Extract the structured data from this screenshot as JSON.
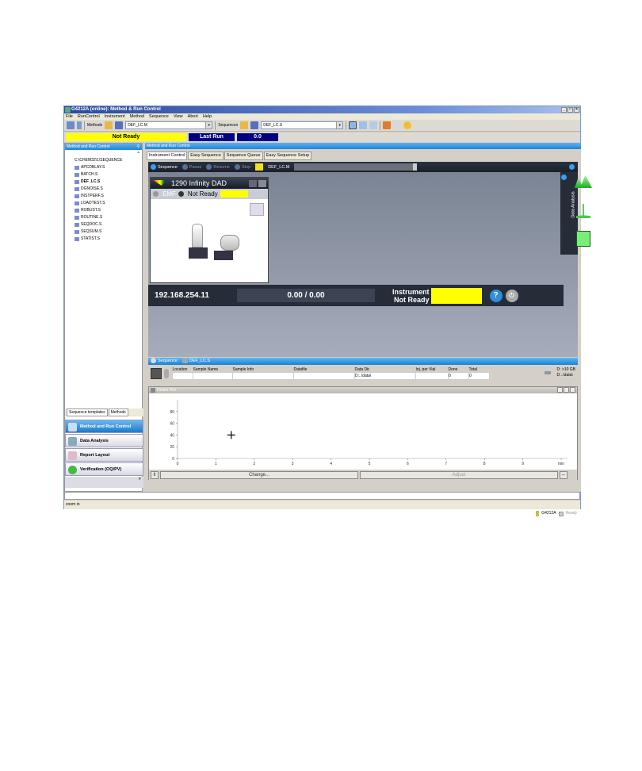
{
  "window": {
    "title": "G4212A (online): Method & Run Control",
    "controls": [
      "_",
      "□",
      "×"
    ]
  },
  "menu": [
    "File",
    "RunControl",
    "Instrument",
    "Method",
    "Sequence",
    "View",
    "Abort",
    "Help"
  ],
  "toolbar": {
    "methods_label": "Methods",
    "method_value": "DEF_LC.M",
    "sequences_label": "Sequences",
    "sequence_value": "DEF_LC.S"
  },
  "status_row": {
    "status": "Not Ready",
    "last_run_label": "Last Run",
    "last_run_value": "0.0"
  },
  "left_panel": {
    "header": "Method and Run Control",
    "root": "C:\\CHEM32\\1\\SEQUENCE",
    "items": [
      "APCDBLAY.S",
      "BATCH.S",
      "DEF_LC.S",
      "DGNOISE.S",
      "INSTPERF.S",
      "LOADTEST.S",
      "ROBUST.S",
      "ROUTINE.S",
      "SEQDOC.S",
      "SEQSUM.S",
      "STATIST.S"
    ],
    "selected": "DEF_LC.S",
    "tabs": [
      "Sequence templates",
      "Methods"
    ]
  },
  "nav": [
    {
      "label": "Method and Run Control",
      "active": true
    },
    {
      "label": "Data Analysis",
      "active": false
    },
    {
      "label": "Report Layout",
      "active": false
    },
    {
      "label": "Verification (OQ/PV)",
      "active": false
    }
  ],
  "main": {
    "header": "Method and Run Control",
    "tabs": [
      "Instrument Control",
      "Easy Sequence",
      "Sequence Queue",
      "Easy Sequence Setup"
    ],
    "seq_controls": {
      "sequence": "Sequence",
      "pause": "Pause",
      "resume": "Resume",
      "stop": "Stop",
      "method": "DEF_LC.M"
    },
    "module": {
      "name": "1290 Infinity DAD",
      "emf": "EMF",
      "status": "Not Ready"
    },
    "info": {
      "ip": "192.168.254.11",
      "progress": "0.00 / 0.00",
      "instrument_status_line1": "Instrument",
      "instrument_status_line2": "Not Ready"
    },
    "data_analysis_label": "Data Analysis",
    "lower_header": {
      "sequence": "Sequence",
      "file": "DEF_LC.S"
    },
    "seq_table": {
      "columns": [
        "Location",
        "Sample Name",
        "Sample Info",
        "Datafile",
        "Data Dir.",
        "Inj. per Vial",
        "Done",
        "Total"
      ],
      "row": [
        "",
        "",
        "",
        "",
        "D:..\\data\\",
        "",
        "0",
        "0"
      ]
    },
    "disk": {
      "line1": "D: >10 GB",
      "line2": "D:..\\data\\"
    },
    "plot": {
      "title": "Online Plot",
      "change": "Change...",
      "adjust": "Adjust"
    }
  },
  "chart_data": {
    "type": "line",
    "title": "Online Plot",
    "xlabel": "min",
    "ylabel": "",
    "xlim": [
      0,
      10
    ],
    "ylim": [
      0,
      100
    ],
    "x_ticks": [
      "0",
      "1",
      "2",
      "3",
      "4",
      "5",
      "6",
      "7",
      "8",
      "9",
      "min"
    ],
    "y_ticks": [
      "0",
      "20",
      "40",
      "60",
      "80"
    ],
    "series": []
  },
  "statusbar": {
    "text": "zoom in",
    "instrument": "G4212A",
    "state": "Ready"
  }
}
